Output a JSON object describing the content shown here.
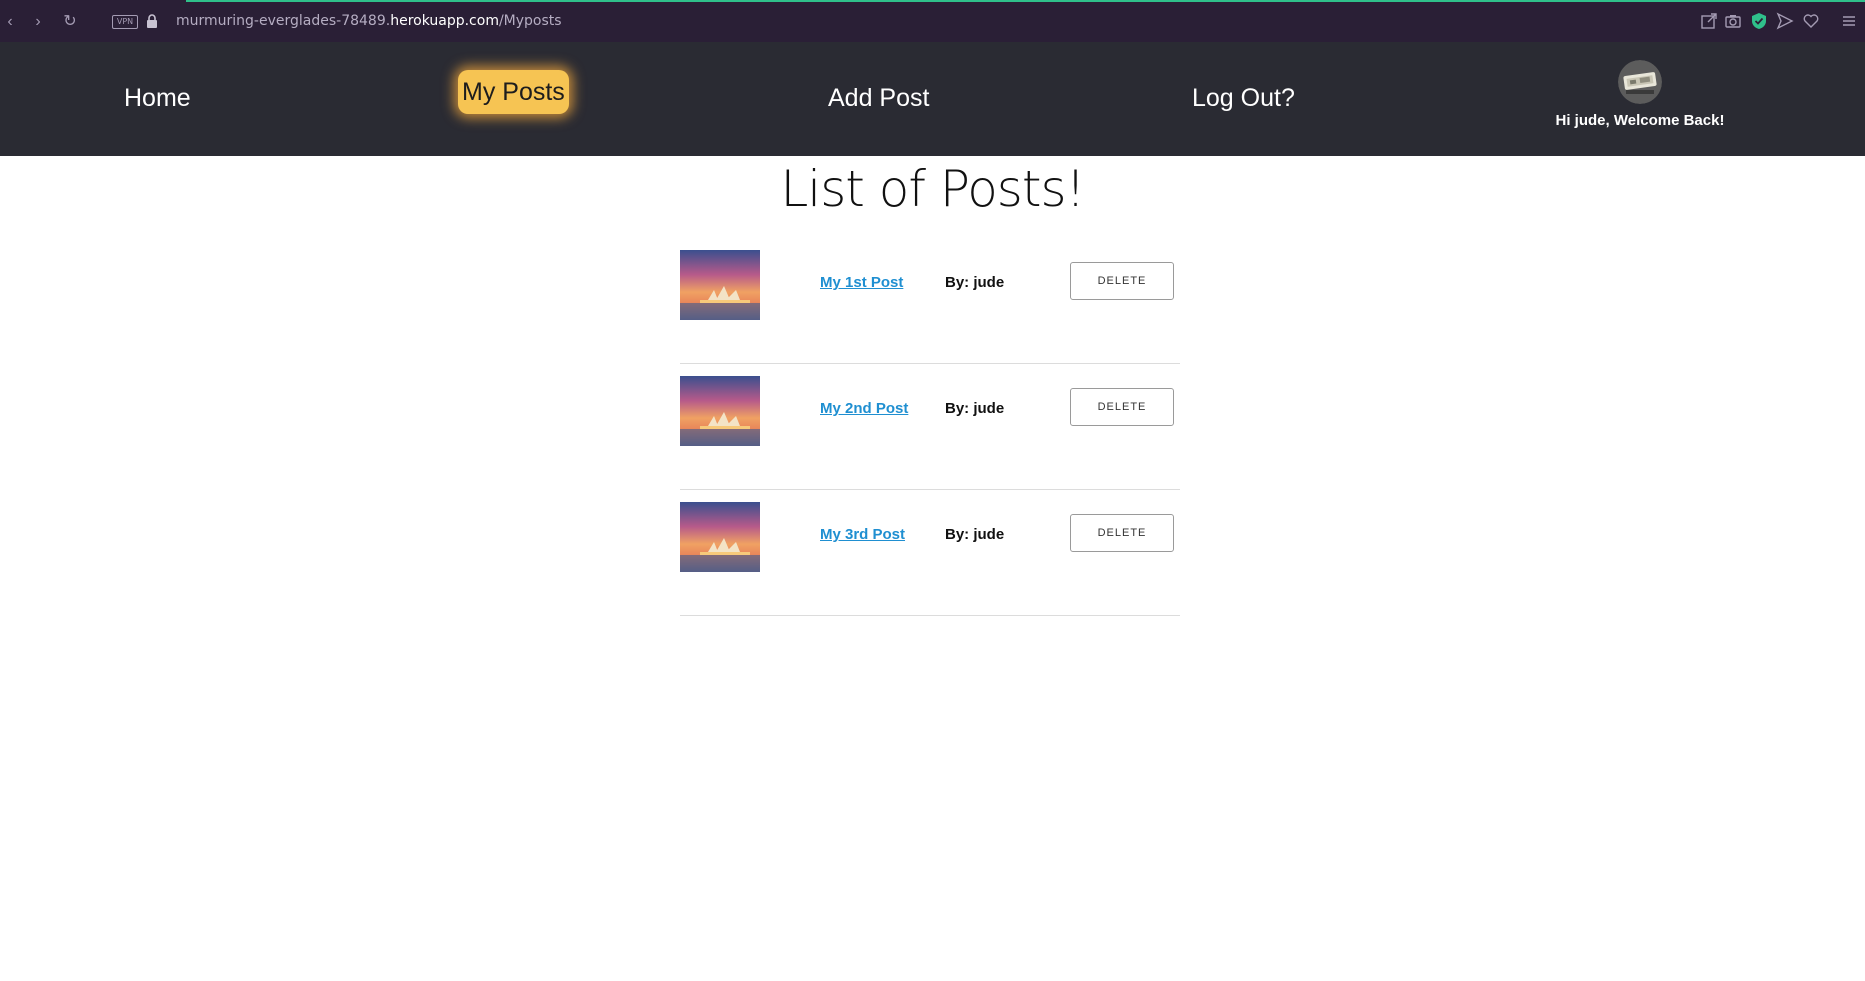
{
  "browser": {
    "vpn_label": "VPN",
    "url_prefix": "murmuring-everglades-78489.",
    "url_host": "herokuapp.com",
    "url_path": "/Myposts"
  },
  "nav": {
    "home": "Home",
    "my_posts": "My Posts",
    "add_post": "Add Post",
    "log_out": "Log Out?",
    "greeting": "Hi jude, Welcome Back!"
  },
  "page": {
    "title": "List of Posts!"
  },
  "posts": [
    {
      "title": "My 1st Post",
      "author": "By: jude",
      "delete_label": "DELETE"
    },
    {
      "title": "My 2nd Post",
      "author": "By: jude",
      "delete_label": "DELETE"
    },
    {
      "title": "My 3rd Post",
      "author": "By: jude",
      "delete_label": "DELETE"
    }
  ],
  "colors": {
    "browser_bar": "#2a1f36",
    "header": "#2a2b33",
    "active_tab": "#f6c453",
    "link": "#1f8fd1"
  }
}
